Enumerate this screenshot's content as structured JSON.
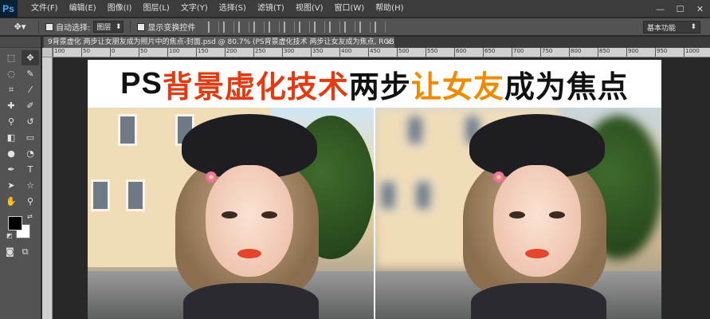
{
  "app": {
    "logo": "Ps"
  },
  "menu": [
    "文件(F)",
    "编辑(E)",
    "图像(I)",
    "图层(L)",
    "文字(Y)",
    "选择(S)",
    "滤镜(T)",
    "视图(V)",
    "窗口(W)",
    "帮助(H)"
  ],
  "window_controls": {
    "minimize": "—",
    "maximize": "☐",
    "close": "✕"
  },
  "options": {
    "auto_select_label": "自动选择:",
    "auto_select_value": "图层",
    "show_transform_label": "显示变换控件",
    "workspace": "基本功能"
  },
  "document": {
    "tab_title": "9背景虚化 两步让女朋友成为照片中的焦点-封面.psd @ 80.7% (PS背景虚化技术 两步让女友成为焦点, RGB/8#)",
    "close": "×"
  },
  "ruler_ticks": [
    "100",
    "50",
    "0",
    "50",
    "100",
    "150",
    "200",
    "250",
    "300",
    "350",
    "400",
    "450",
    "500",
    "550",
    "600",
    "650",
    "700",
    "750",
    "800",
    "850",
    "900",
    "950",
    "1000"
  ],
  "artwork": {
    "headline_part1": "PS",
    "headline_part2": "背景虚化技术",
    "headline_part3": " 两步",
    "headline_part4": "让女友",
    "headline_part5": "成为焦点"
  },
  "colors": {
    "accent_red": "#e43a12",
    "accent_orange": "#f08a00",
    "ps_blue": "#4fa8f0"
  }
}
